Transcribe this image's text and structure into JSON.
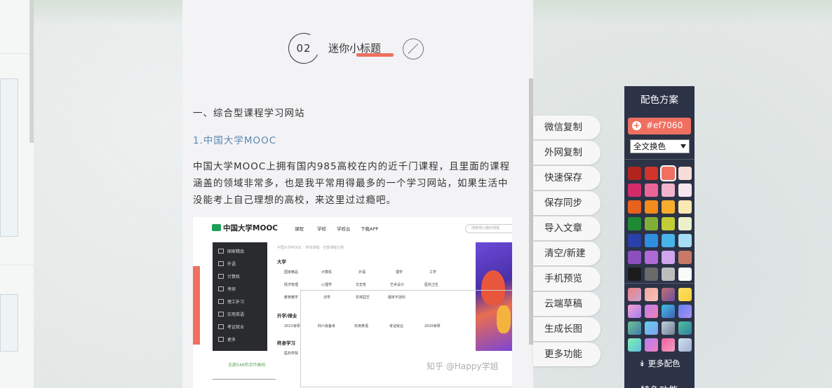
{
  "article": {
    "mini_title": {
      "number": "02",
      "text": "迷你小标题"
    },
    "section_heading": "一、综合型课程学习网站",
    "sub_heading": "1.中国大学MOOC",
    "paragraph": "中国大学MOOC上拥有国内985高校在内的近千门课程，且里面的课程涵盖的领域非常多，也是我平常用得最多的一个学习网站，如果生活中没能考上自己理想的高校，来这里过过瘾吧。",
    "screenshot": {
      "logo": "中国大学MOOC",
      "nav": [
        "课程",
        "学校",
        "学校云",
        "下载APP"
      ],
      "search_placeholder": "搜索感兴趣的课程",
      "crumb": "中国大学MOOC · 所有课程 · 全部课程分类",
      "sidebar": [
        "国家精品",
        "外语",
        "计算机",
        "考研",
        "理工补习",
        "实用英语",
        "考证就业",
        "更多"
      ],
      "sections": [
        {
          "title": "大学",
          "cells": [
            "国家精品",
            "计算机",
            "外语",
            "理学",
            "工学",
            "经济管理",
            "心理学",
            "文史哲",
            "艺术设计",
            "医药卫生",
            "教育教学",
            "法学",
            "农林园艺",
            "期末不挂科"
          ]
        },
        {
          "title": "升学/择业",
          "cells": [
            "2021考研",
            "四六级备考",
            "实用英语",
            "考证就业",
            "2020考研"
          ]
        },
        {
          "title": "终身学习",
          "cells": [
            "医药学院"
          ]
        }
      ],
      "footer": "全部546所合作高校",
      "watermark": "知乎 @Happy学姐"
    }
  },
  "actions": [
    "微信复制",
    "外网复制",
    "快速保存",
    "保存同步",
    "导入文章",
    "清空/新建",
    "手机预览",
    "云端草稿",
    "生成长图",
    "更多功能"
  ],
  "color_panel": {
    "title": "配色方案",
    "current_hex": "#ef7060",
    "scope": "全文换色",
    "accent": "#ef7060",
    "solid_swatches": [
      "#b1241c",
      "#d0352c",
      "#ef7060",
      "#f7ddd8",
      "#d42a6a",
      "#ea6598",
      "#f2b4cd",
      "#f7e6ee",
      "#e8611e",
      "#f38a1c",
      "#f7ac2d",
      "#fae8b3",
      "#1f8a34",
      "#7fb035",
      "#c2cc35",
      "#ecf1cc",
      "#2940a8",
      "#2f8ee0",
      "#47b4ea",
      "#a6dcf4",
      "#8c4fbf",
      "#b06ad7",
      "#d0a6ec",
      "#c87a67",
      "#1c1c1c",
      "#6a6a6a",
      "#bdbdbd",
      "#fafafa"
    ],
    "gradient_swatches": [
      [
        "#f08080",
        "#c8a2d0"
      ],
      [
        "#f6a6a0",
        "#f2c4b8"
      ],
      [
        "#c07070",
        "#7050a0"
      ],
      [
        "#ffe060",
        "#f8d040"
      ],
      [
        "#f7a0d0",
        "#a080f0"
      ],
      [
        "#c080f0",
        "#f080b0"
      ],
      [
        "#40c0e0",
        "#4060c0"
      ],
      [
        "#6080f0",
        "#b090f0"
      ],
      [
        "#70c090",
        "#4080b0"
      ],
      [
        "#60d0f0",
        "#80a0f0"
      ],
      [
        "#c0d0e0",
        "#708090"
      ],
      [
        "#50c0a0",
        "#3080a0"
      ],
      [
        "#80f0b0",
        "#60c0e0"
      ],
      [
        "#b080f0",
        "#f080c0"
      ],
      [
        "#f060a0",
        "#f0a0c0"
      ],
      [
        "#d0e0f0",
        "#a0b0d0"
      ]
    ],
    "more_colors": "更多配色",
    "special": "特色功能"
  }
}
